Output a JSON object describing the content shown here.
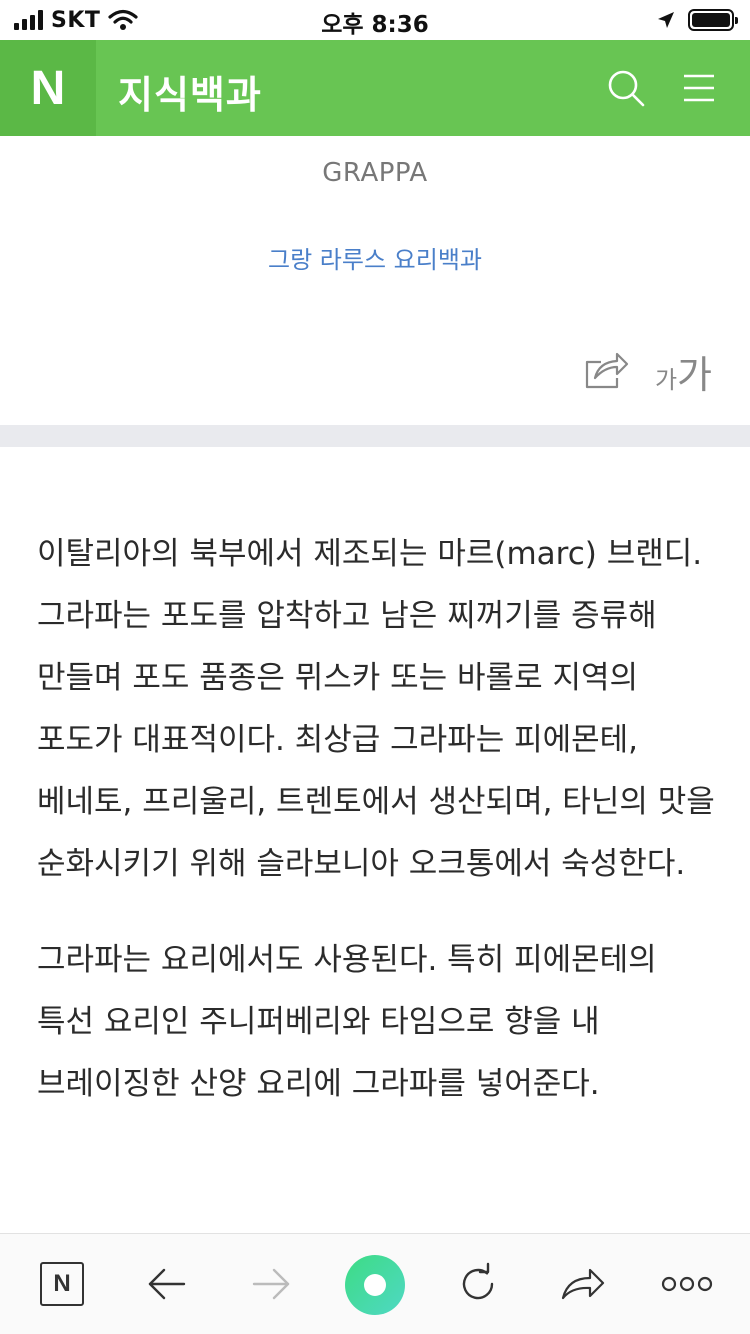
{
  "status_bar": {
    "carrier": "SKT",
    "time": "오후 8:36"
  },
  "header": {
    "logo_letter": "N",
    "title": "지식백과"
  },
  "entry": {
    "title": "GRAPPA",
    "source": "그랑 라루스 요리백과",
    "font_small": "가",
    "font_large": "가"
  },
  "article": {
    "paragraphs": [
      "이탈리아의 북부에서 제조되는 마르(marc) 브랜디. 그라파는 포도를 압착하고 남은 찌꺼기를 증류해 만들며 포도 품종은 뮈스카 또는 바롤로 지역의 포도가 대표적이다. 최상급 그라파는 피에몬테, 베네토, 프리울리, 트렌토에서 생산되며, 타닌의 맛을 순화시키기 위해 슬라보니아 오크통에서 숙성한다.",
      "그라파는 요리에서도 사용된다. 특히 피에몬테의 특선 요리인 주니퍼베리와 타임으로 향을 내 브레이징한 산양 요리에 그라파를 넣어준다."
    ]
  },
  "bottom_bar": {
    "home_letter": "N"
  },
  "colors": {
    "header_green": "#68c553",
    "logo_green": "#5bb846",
    "link_blue": "#4a7fc9"
  }
}
